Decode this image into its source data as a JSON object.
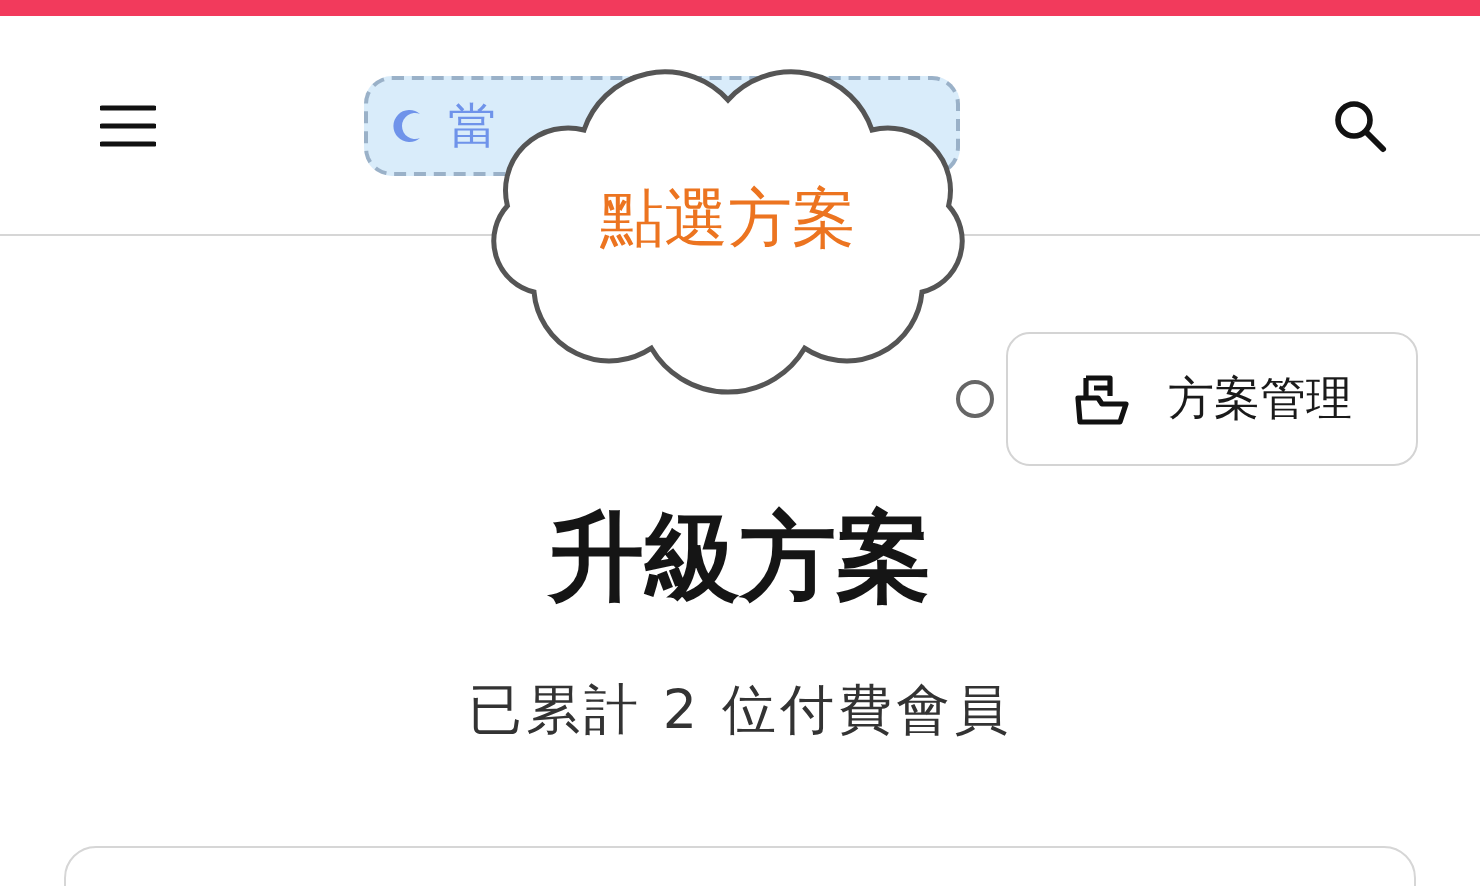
{
  "header": {
    "badge": {
      "text": "當"
    }
  },
  "callout": {
    "text": "點選方案"
  },
  "manage_button": {
    "label": "方案管理"
  },
  "page": {
    "title": "升級方案",
    "subtitle": "已累計 2 位付費會員"
  }
}
